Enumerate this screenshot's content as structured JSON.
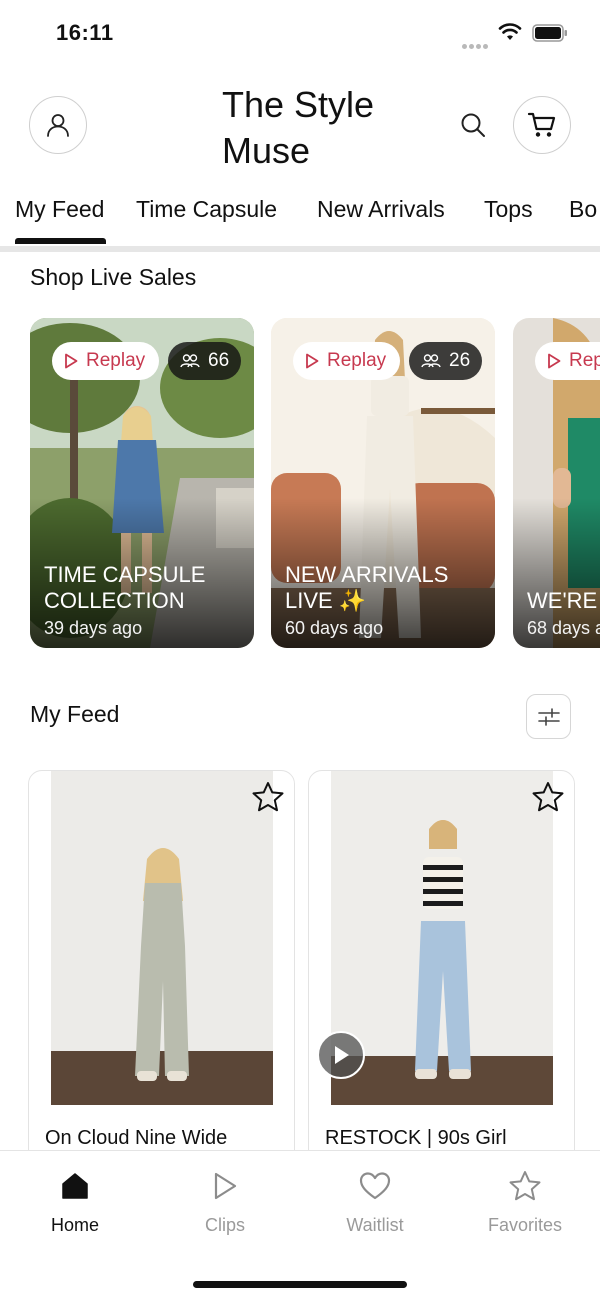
{
  "status_bar": {
    "time": "16:11"
  },
  "header": {
    "brand_line1": "The Style",
    "brand_line2": "Muse"
  },
  "tabs": [
    {
      "label": "My Feed",
      "active": true
    },
    {
      "label": "Time Capsule"
    },
    {
      "label": "New Arrivals"
    },
    {
      "label": "Tops"
    },
    {
      "label": "Bo"
    }
  ],
  "live_section": {
    "title": "Shop Live Sales",
    "cards": [
      {
        "replay_label": "Replay",
        "viewers": "66",
        "title_line1": "TIME CAPSULE",
        "title_line2": "COLLECTION",
        "ago": "39 days ago"
      },
      {
        "replay_label": "Replay",
        "viewers": "26",
        "title_line1": "NEW ARRIVALS",
        "title_line2": "LIVE ✨",
        "ago": "60 days ago"
      },
      {
        "replay_label": "Rep",
        "title_line1": "WE'RE",
        "title_line2": "",
        "ago": "68 days a"
      }
    ]
  },
  "feed": {
    "title": "My Feed",
    "products": [
      {
        "name": "On Cloud Nine Wide",
        "has_video": false
      },
      {
        "name": "RESTOCK | 90s Girl",
        "has_video": true
      }
    ]
  },
  "bottom_nav": {
    "items": [
      {
        "label": "Home",
        "icon": "home-icon",
        "active": true
      },
      {
        "label": "Clips",
        "icon": "play-icon"
      },
      {
        "label": "Waitlist",
        "icon": "heart-icon"
      },
      {
        "label": "Favorites",
        "icon": "star-icon"
      }
    ]
  },
  "colors": {
    "accent_red": "#c7394f",
    "text": "#111111",
    "muted": "#9a9a9a",
    "divider": "#e6e6e6"
  }
}
